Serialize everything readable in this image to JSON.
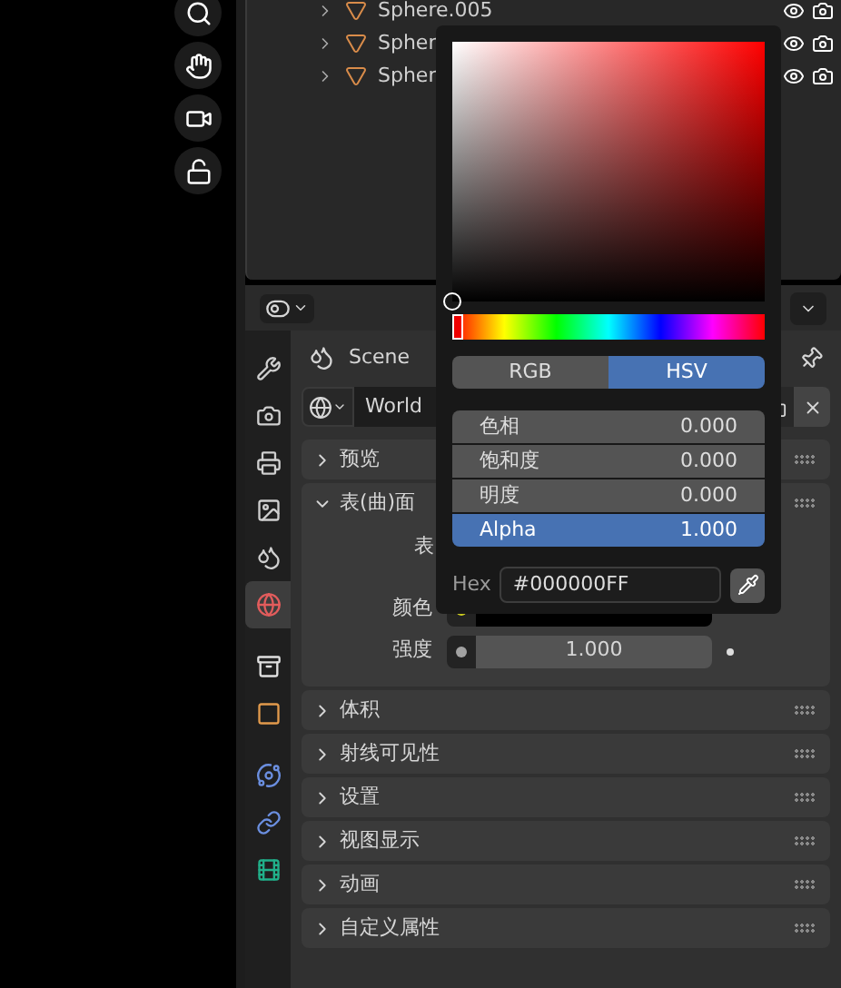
{
  "outliner": {
    "rows": [
      {
        "name": "Sphere.005"
      },
      {
        "name": "Spher"
      },
      {
        "name": "Spher"
      }
    ]
  },
  "properties": {
    "breadcrumb": "Scene",
    "world_name": "World",
    "tabs": [
      {
        "kind": "tool",
        "selected": false
      },
      {
        "kind": "render",
        "selected": false
      },
      {
        "kind": "output",
        "selected": false
      },
      {
        "kind": "view_layer",
        "selected": false
      },
      {
        "kind": "scene",
        "selected": false
      },
      {
        "kind": "world",
        "selected": true
      },
      {
        "kind": "collection",
        "selected": false
      },
      {
        "kind": "object",
        "selected": false
      },
      {
        "kind": "physics",
        "selected": false
      },
      {
        "kind": "constraints",
        "selected": false
      },
      {
        "kind": "data",
        "selected": false
      }
    ],
    "panels": [
      {
        "title": "预览",
        "expanded": false
      },
      {
        "title": "表(曲)面",
        "expanded": true,
        "label": "表",
        "fields": [
          {
            "label": "颜色",
            "kind": "color",
            "color": "#c8c81e"
          },
          {
            "label": "强度",
            "kind": "number",
            "color": "#a1a1a1",
            "value": "1.000"
          }
        ]
      },
      {
        "title": "体积",
        "expanded": false
      },
      {
        "title": "射线可见性",
        "expanded": false
      },
      {
        "title": "设置",
        "expanded": false
      },
      {
        "title": "视图显示",
        "expanded": false
      },
      {
        "title": "动画",
        "expanded": false
      },
      {
        "title": "自定义属性",
        "expanded": false
      }
    ]
  },
  "color_picker": {
    "hue_slider": {
      "level": 0
    },
    "modes": [
      {
        "label": "RGB",
        "selected": false
      },
      {
        "label": "HSV",
        "selected": true
      }
    ],
    "fields": [
      {
        "label": "色相",
        "value": "0.000",
        "selected": false
      },
      {
        "label": "饱和度",
        "value": "0.000",
        "selected": false
      },
      {
        "label": "明度",
        "value": "0.000",
        "selected": false
      },
      {
        "label": "Alpha",
        "value": "1.000",
        "selected": true
      }
    ],
    "hex_label": "Hex",
    "hex_value": "#000000FF"
  }
}
